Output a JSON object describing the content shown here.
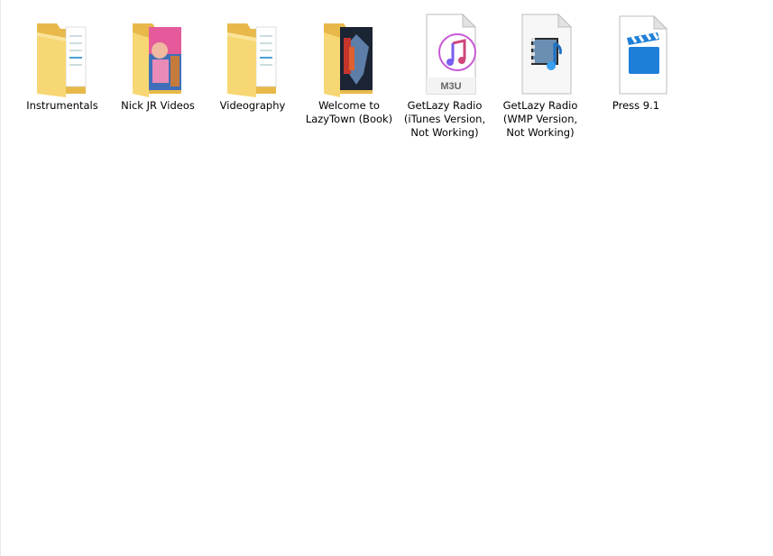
{
  "items": [
    {
      "name": "Instrumentals",
      "type": "folder",
      "icon": "folder-documents-icon"
    },
    {
      "name": "Nick JR Videos",
      "type": "folder",
      "icon": "folder-photo-icon"
    },
    {
      "name": "Videography",
      "type": "folder",
      "icon": "folder-documents-icon"
    },
    {
      "name": "Welcome to\nLazyTown (Book)",
      "type": "folder",
      "icon": "folder-photo-icon"
    },
    {
      "name": "GetLazy Radio\n(iTunes Version,\nNot Working)",
      "type": "file",
      "icon": "itunes-m3u-file-icon",
      "badge": "M3U"
    },
    {
      "name": "GetLazy Radio\n(WMP Version,\nNot Working)",
      "type": "file",
      "icon": "wmp-playlist-file-icon"
    },
    {
      "name": "Press 9.1",
      "type": "file",
      "icon": "video-clapper-file-icon"
    }
  ],
  "colors": {
    "folder": "#f7d774",
    "folder_dark": "#e8b94a",
    "itunes_accent": "#c85ad6",
    "clapper_blue": "#1e7fd8"
  }
}
